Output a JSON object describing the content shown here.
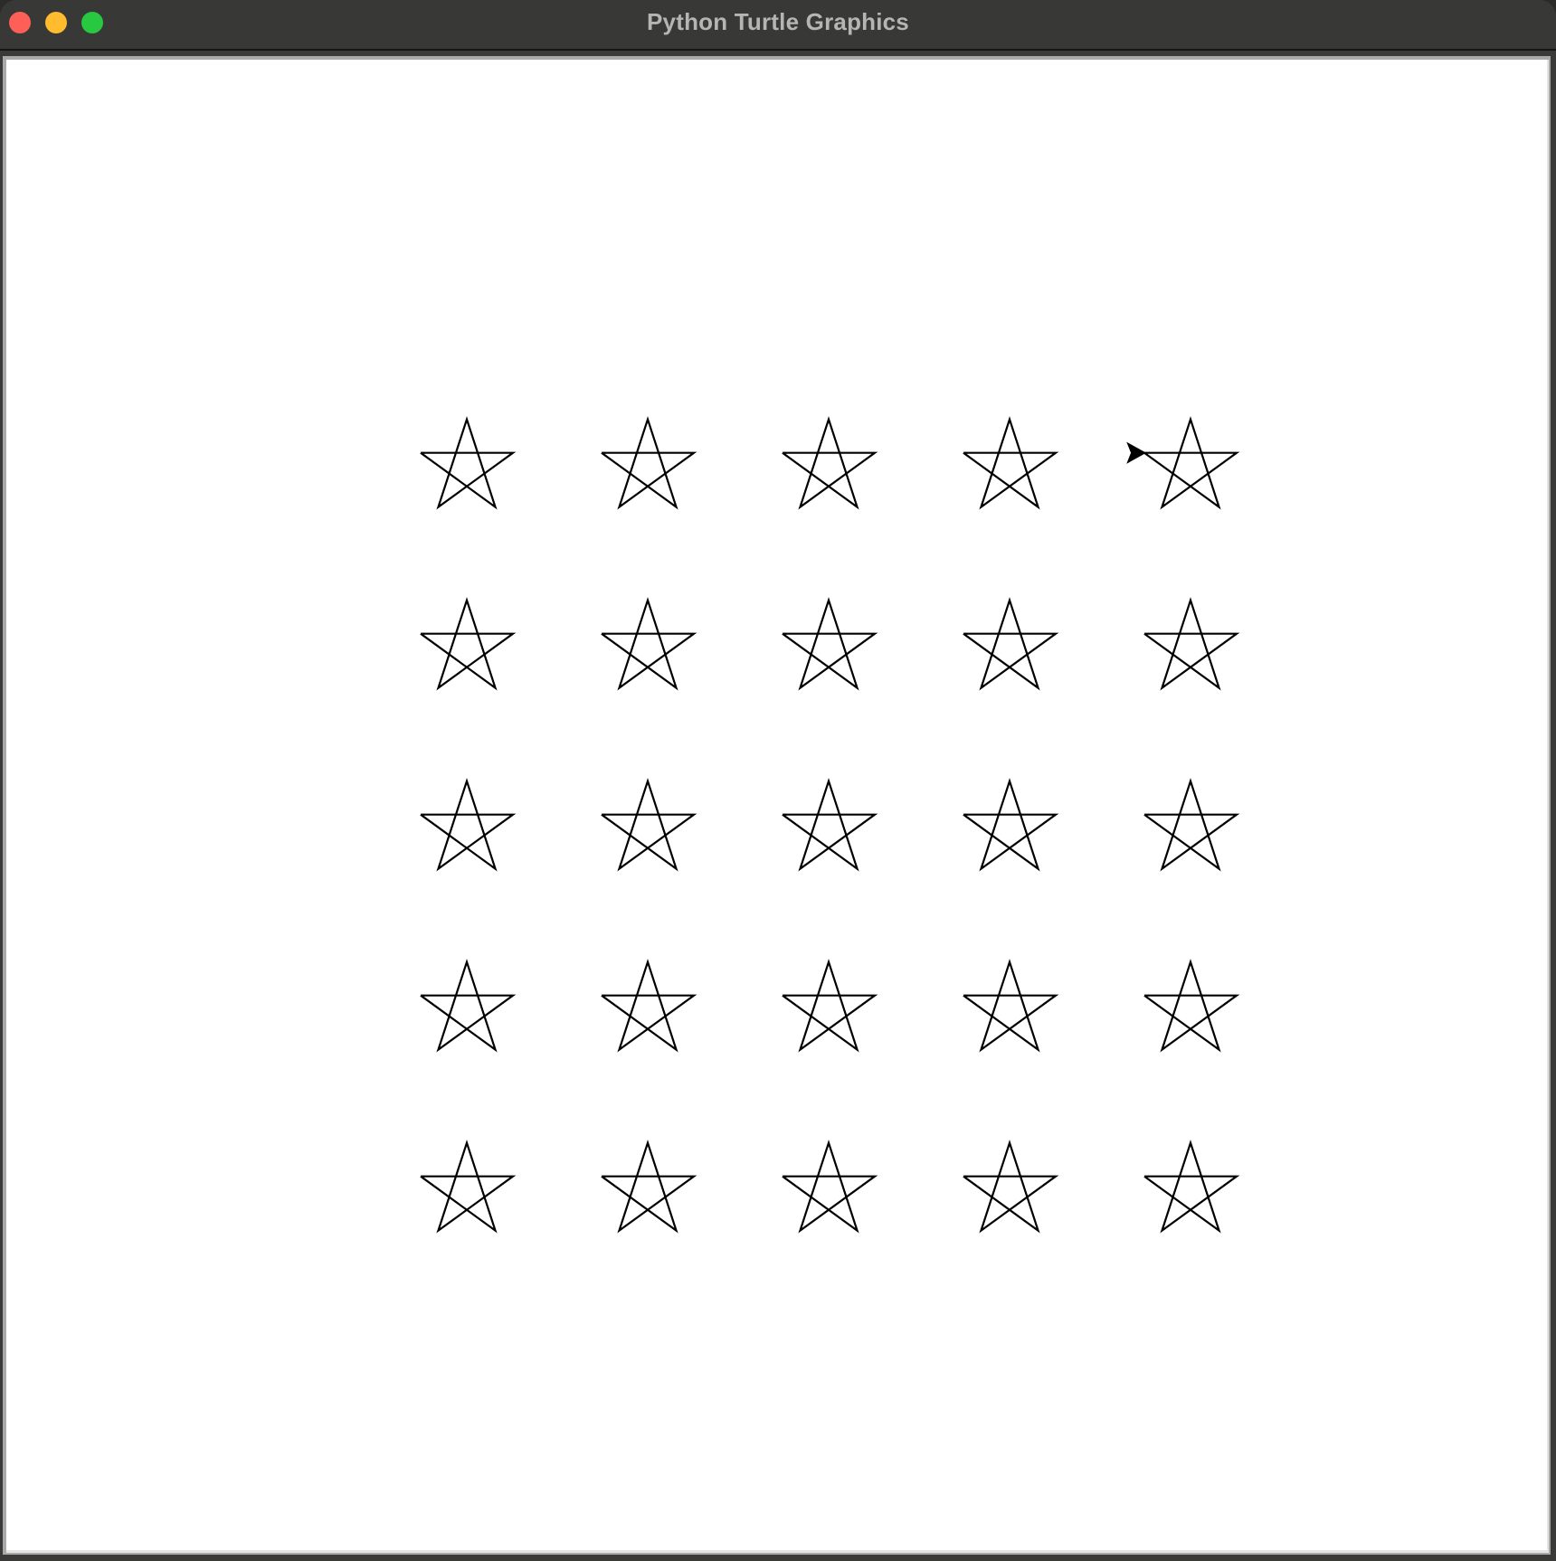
{
  "window": {
    "title": "Python Turtle Graphics",
    "controls": [
      {
        "name": "close",
        "color": "#fe5f57"
      },
      {
        "name": "minimize",
        "color": "#febc2e"
      },
      {
        "name": "maximize",
        "color": "#28c840"
      }
    ]
  },
  "canvas": {
    "background": "#ffffff",
    "pen_color": "#000000",
    "shape": "star",
    "star_points": 5,
    "turn_angle_deg": 144,
    "grid": {
      "rows": 5,
      "columns": 5,
      "total_stars": 25
    },
    "turtle": {
      "shape": "classic",
      "heading": "east",
      "color": "#000000",
      "location": "row 1, column 5 (left point of star)"
    }
  }
}
